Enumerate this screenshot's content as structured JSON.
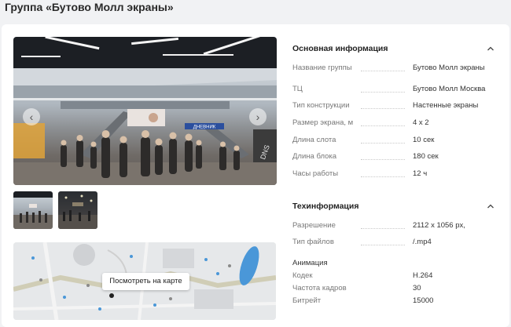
{
  "page": {
    "title": "Группа «Бутово Молл экраны»"
  },
  "gallery": {
    "prev_icon": "chevron-left-icon",
    "next_icon": "chevron-right-icon",
    "prev_glyph": "‹",
    "next_glyph": "›",
    "thumbnails": 2
  },
  "map": {
    "button_label": "Посмотреть на карте"
  },
  "basic_info": {
    "title": "Основная информация",
    "rows": [
      {
        "label": "Название группы",
        "value": "Бутово Молл экраны"
      },
      {
        "label": "ТЦ",
        "value": "Бутово Молл Москва"
      },
      {
        "label": "Тип конструкции",
        "value": "Настенные экраны"
      },
      {
        "label": "Размер экрана, м",
        "value": "4 x 2"
      },
      {
        "label": "Длина слота",
        "value": "10 сек"
      },
      {
        "label": "Длина блока",
        "value": "180 сек"
      },
      {
        "label": "Часы работы",
        "value": "12 ч"
      }
    ]
  },
  "tech_info": {
    "title": "Техинформация",
    "rows": [
      {
        "label": "Разрешение",
        "value": "2112 x 1056 px,"
      },
      {
        "label": "Тип файлов",
        "value": "/.mp4"
      }
    ],
    "animation": {
      "title": "Анимация",
      "rows": [
        {
          "label": "Кодек",
          "value": "H.264"
        },
        {
          "label": "Частота кадров",
          "value": "30"
        },
        {
          "label": "Битрейт",
          "value": "15000"
        }
      ]
    }
  },
  "photo_signs": {
    "store": "ДНЕВНИК",
    "dns": "DNS"
  }
}
